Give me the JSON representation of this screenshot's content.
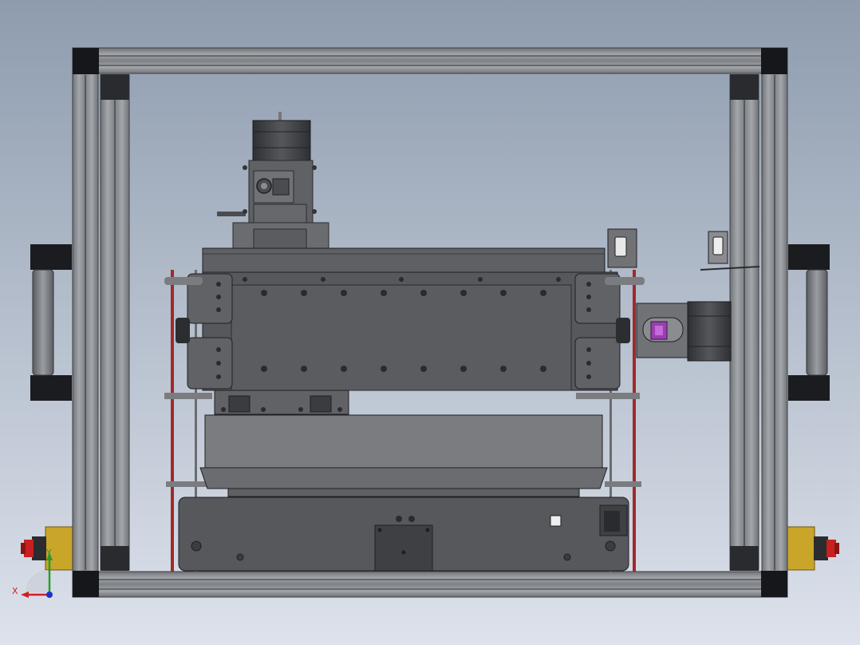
{
  "viewport": {
    "background_top": "#8e9cae",
    "background_bottom": "#dde2ec"
  },
  "colors": {
    "extrusion": "#8c8f93",
    "extrusion_dark": "#4a4c50",
    "corner_bracket": "#16171a",
    "body": "#57595d",
    "body_dark": "#3c3e42",
    "body_light": "#6c6e72",
    "red_rod": "#a02a2a",
    "yellow_box": "#c9a52a",
    "estop_red": "#c82020",
    "coupler_purple": "#9a3fb0",
    "triad_x": "#d22020",
    "triad_y": "#2a9a2a",
    "triad_z": "#2030c8"
  },
  "model": {
    "parts": [
      "frame",
      "left-handle",
      "right-handle",
      "gantry",
      "spindle-motor",
      "stepper-motor",
      "tray",
      "base-enclosure",
      "limit-switch",
      "emergency-stop-left",
      "emergency-stop-right"
    ]
  },
  "triad": {
    "x_label": "X",
    "y_label": "Y"
  }
}
